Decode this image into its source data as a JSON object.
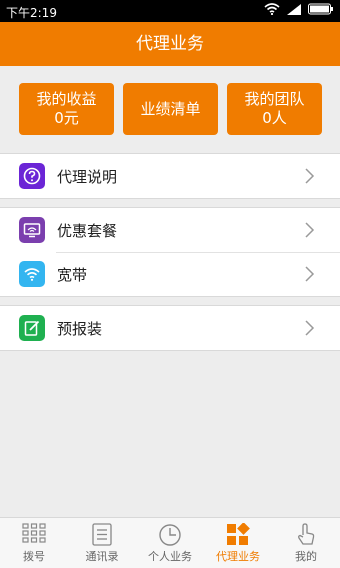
{
  "status": {
    "time": "下午2:19"
  },
  "header": {
    "title": "代理业务"
  },
  "cards": [
    {
      "line1": "我的收益",
      "line2": "0元"
    },
    {
      "line1": "业绩清单",
      "line2": ""
    },
    {
      "line1": "我的团队",
      "line2": "0人"
    }
  ],
  "menu": {
    "group1": [
      {
        "label": "代理说明",
        "icon": "question-icon",
        "color": "#6b25d6"
      }
    ],
    "group2": [
      {
        "label": "优惠套餐",
        "icon": "tv-icon",
        "color": "#7b3fae"
      },
      {
        "label": "宽带",
        "icon": "wifi-icon",
        "color": "#33b5f0"
      }
    ],
    "group3": [
      {
        "label": "预报装",
        "icon": "edit-icon",
        "color": "#1fb050"
      }
    ]
  },
  "tabs": [
    {
      "label": "拨号",
      "icon": "dialpad-icon"
    },
    {
      "label": "通讯录",
      "icon": "contacts-icon"
    },
    {
      "label": "个人业务",
      "icon": "clock-icon"
    },
    {
      "label": "代理业务",
      "icon": "agent-icon",
      "active": true
    },
    {
      "label": "我的",
      "icon": "hand-icon"
    }
  ],
  "colors": {
    "accent": "#f07c00",
    "background": "#ededed"
  }
}
